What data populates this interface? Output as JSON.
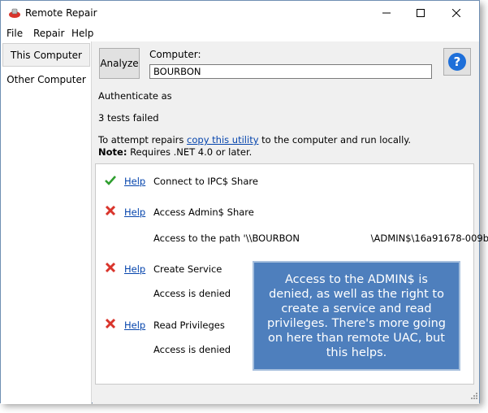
{
  "window": {
    "title": "Remote Repair"
  },
  "menu": {
    "items": [
      "File",
      "Repair",
      "Help"
    ]
  },
  "tabs": [
    "This Computer",
    "Other Computer"
  ],
  "toolbar": {
    "analyze_label": "Analyze",
    "computer_label": "Computer:",
    "computer_value": "BOURBON"
  },
  "status": {
    "authenticate": "Authenticate as",
    "tests_failed": "3 tests failed",
    "repair_prefix": "To attempt repairs ",
    "repair_link": "copy this utility",
    "repair_suffix": " to the computer and run locally.",
    "note_label": "Note:",
    "note_text": " Requires .NET 4.0 or later."
  },
  "tests": [
    {
      "status": "pass",
      "help": "Help",
      "name": "Connect to IPC$ Share",
      "detail": ""
    },
    {
      "status": "fail",
      "help": "Help",
      "name": "Access Admin$ Share",
      "detail": "Access to the path '\\\\BOURBON                        \\ADMIN$\\16a91678-009b"
    },
    {
      "status": "fail",
      "help": "Help",
      "name": "Create Service",
      "detail": "Access is denied"
    },
    {
      "status": "fail",
      "help": "Help",
      "name": "Read Privileges",
      "detail": "Access is denied"
    }
  ],
  "callout": {
    "text": "Access to the ADMIN$ is denied, as well as the right to create a service and read privileges. There's more going on here than remote UAC, but this helps."
  },
  "colors": {
    "accent": "#4e7fbd",
    "help_blue": "#1e6fd9",
    "pass": "#2e9e2e",
    "fail": "#d9342b",
    "link": "#0645ad"
  }
}
